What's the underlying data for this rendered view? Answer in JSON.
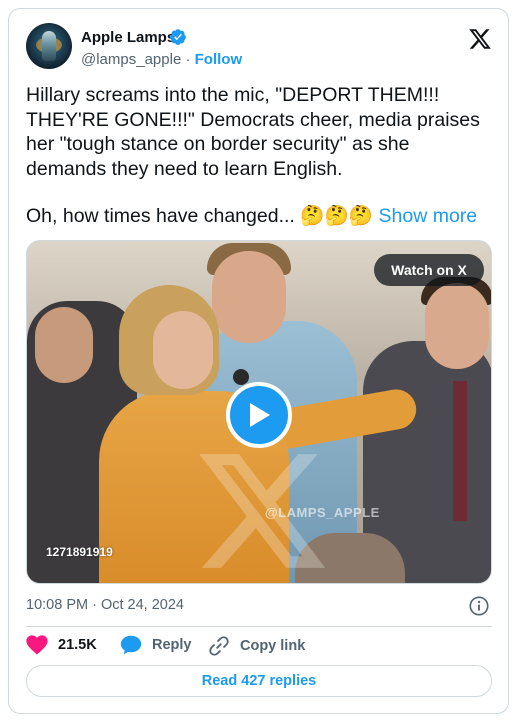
{
  "author": {
    "name": "Apple Lamps",
    "handle": "@lamps_apple",
    "separator": " · ",
    "follow_label": "Follow"
  },
  "tweet": {
    "lines": [
      "Hillary screams into the mic, \"DEPORT THEM!!!",
      "THEY'RE GONE!!!\" Democrats cheer, media praises",
      "her \"tough stance on border security\" as she",
      "demands they need to learn English."
    ],
    "closing": "Oh, how times have changed...",
    "emojis": "🤔🤔🤔",
    "show_more_label": "Show more"
  },
  "media": {
    "watch_label": "Watch on X",
    "video_id": "1271891919",
    "watermark_handle": "@LAMPS_APPLE"
  },
  "meta": {
    "timestamp": "10:08 PM · Oct 24, 2024"
  },
  "actions": {
    "likes": "21.5K",
    "reply_label": "Reply",
    "copy_label": "Copy link"
  },
  "footer": {
    "read_replies": "Read 427 replies"
  },
  "colors": {
    "accent": "#1d9bf0",
    "like": "#f91880",
    "muted": "#536471",
    "text": "#0f1419",
    "border": "#cfd9de"
  },
  "icons": [
    "verified-badge-icon",
    "x-logo-icon",
    "play-icon",
    "info-icon",
    "heart-icon",
    "reply-bubble-icon",
    "link-icon"
  ]
}
